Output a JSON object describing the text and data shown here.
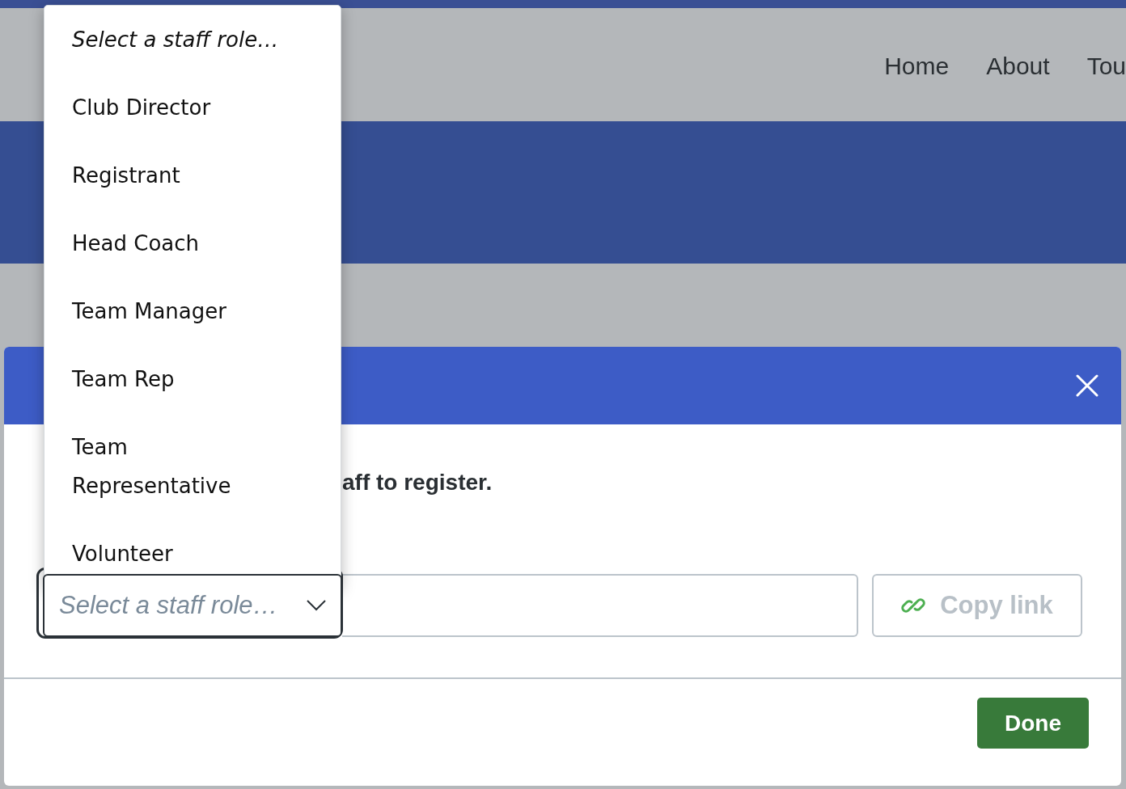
{
  "nav": {
    "items": [
      "Home",
      "About",
      "Tou"
    ]
  },
  "modal": {
    "message": "aff to register.",
    "role_select": {
      "placeholder": "Select a staff role…"
    },
    "copy_button": {
      "label": "Copy link",
      "disabled": true
    },
    "done_button": {
      "label": "Done"
    }
  },
  "role_menu": {
    "options": [
      {
        "label": "Select a staff role…",
        "kind": "placeholder"
      },
      {
        "label": "Club Director",
        "kind": "option"
      },
      {
        "label": "Registrant",
        "kind": "option"
      },
      {
        "label": "Head Coach",
        "kind": "option"
      },
      {
        "label": "Team Manager",
        "kind": "option"
      },
      {
        "label": "Team Rep",
        "kind": "option"
      },
      {
        "label": "Team Representative",
        "kind": "option"
      },
      {
        "label": "Volunteer",
        "kind": "option"
      }
    ]
  }
}
